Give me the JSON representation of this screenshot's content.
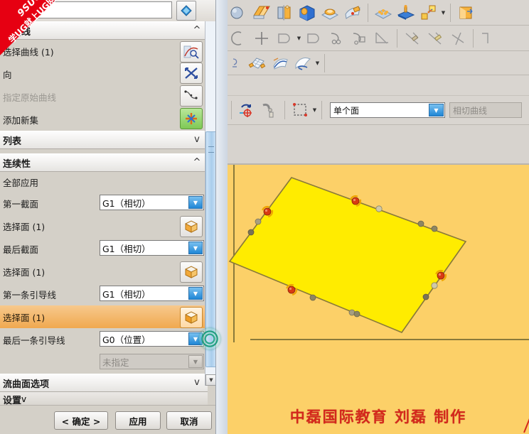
{
  "watermark": {
    "line1": "9SUG",
    "line2": "学UG就上UG网",
    "color": "#e60012"
  },
  "dialog": {
    "title_bar_placeholder": "",
    "groups": {
      "curve_section": {
        "label": "〉曲线",
        "chevron": "^"
      },
      "list_section": {
        "label": "列表",
        "chevron": "v"
      },
      "continuity_section": {
        "label": "连续性",
        "chevron": "^"
      },
      "surface_options_section": {
        "label": "流曲面选项",
        "chevron": "v"
      },
      "settings_section": {
        "label": "设置",
        "chevron": "v"
      }
    },
    "rows": {
      "select_curve": {
        "label": "选择曲线 (1)",
        "icon": "curve-select-icon"
      },
      "reverse_row": {
        "label": "向",
        "icon": "cross-arrows-icon"
      },
      "original_curve": {
        "label": "指定原始曲线",
        "icon": "spline-icon",
        "disabled": true
      },
      "add_new_set": {
        "label": "添加新集",
        "icon": "add-set-icon"
      },
      "apply_all": {
        "label": "全部应用"
      },
      "first_section": {
        "label": "第一截面",
        "value": "G1（相切）"
      },
      "select_face_1": {
        "label": "选择面 (1)",
        "icon": "face-cube-icon"
      },
      "last_section": {
        "label": "最后截面",
        "value": "G1（相切）"
      },
      "select_face_2": {
        "label": "选择面 (1)",
        "icon": "face-cube-icon"
      },
      "first_guide": {
        "label": "第一条引导线",
        "value": "G1（相切）"
      },
      "select_face_3": {
        "label": "选择面 (1)",
        "icon": "face-cube-icon",
        "highlighted": true
      },
      "last_guide": {
        "label": "最后一条引导线",
        "value": "G0（位置）"
      },
      "unspecified": {
        "label": "",
        "value": "未指定",
        "disabled": true
      }
    },
    "buttons": {
      "ok": "< 确定 >",
      "apply": "应用",
      "cancel": "取消"
    },
    "scrollbar": {
      "down_arrow": "▼"
    }
  },
  "toolbars": {
    "row1_icons": [
      "sphere-icon",
      "book-surface-icon",
      "revolve-icon",
      "hole-block-icon",
      "emboss-pad-icon",
      "draft-face-icon",
      "pattern-feature-icon",
      "extrude-boss-icon",
      "move-object-icon",
      "more-dropdown-icon",
      "sheet-metal-icon"
    ],
    "row2_icons": [
      "arc-icon",
      "point-icon",
      "offset-curve-icon",
      "offset-curve-dropdown-icon",
      "offset-curve2-icon",
      "chain-curve-icon",
      "bridge-curve-icon",
      "trim-corner-icon",
      "trim-line-icon",
      "extend-line-icon",
      "intersect-line-icon"
    ],
    "row3_icons": [
      "through-curves-mesh-icon",
      "swept-surface-icon",
      "studio-surface-icon",
      "studio-dropdown-icon",
      "row-overflow-icon"
    ],
    "row4": {
      "icons": [
        "undo-redo-icon",
        "snap-point-icon",
        "selection-filter-icon",
        "rectangle-select-icon",
        "rect-select-dropdown-icon"
      ],
      "scope_value": "单个面",
      "tangent_value": "相切曲线"
    }
  },
  "viewport": {
    "background_color": "#fcd068",
    "surface_color": "#ffec00",
    "edge_color": "#8a7a3a",
    "handle_red": "#d93a12",
    "handle_gray": "#9a9478",
    "credit_line": "中磊国际教育   刘磊   制作",
    "credit_color": "#d4281c"
  }
}
